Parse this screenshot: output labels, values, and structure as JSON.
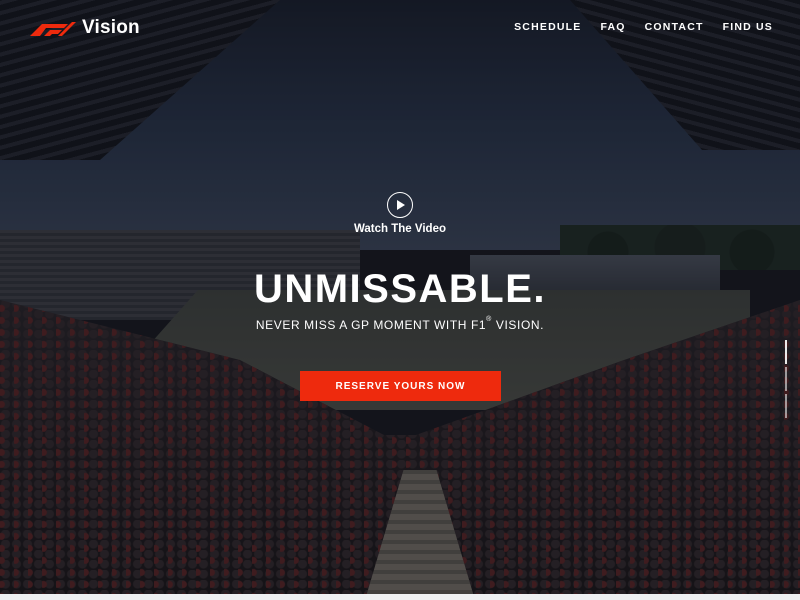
{
  "brand": {
    "logo_text": "Vision",
    "accent_color": "#ee2a0d"
  },
  "nav": {
    "items": [
      {
        "label": "SCHEDULE"
      },
      {
        "label": "FAQ"
      },
      {
        "label": "CONTACT"
      },
      {
        "label": "FIND US"
      }
    ]
  },
  "hero": {
    "watch_label": "Watch The Video",
    "headline": "UNMISSABLE.",
    "subline_before": "NEVER MISS A GP MOMENT WITH F1",
    "subline_mark": "®",
    "subline_after": " VISION.",
    "cta_label": "RESERVE YOURS NOW"
  },
  "icons": {
    "play": "play-icon",
    "logo": "f1-logo-icon"
  },
  "slides": {
    "count": 3,
    "active_index": 0
  }
}
